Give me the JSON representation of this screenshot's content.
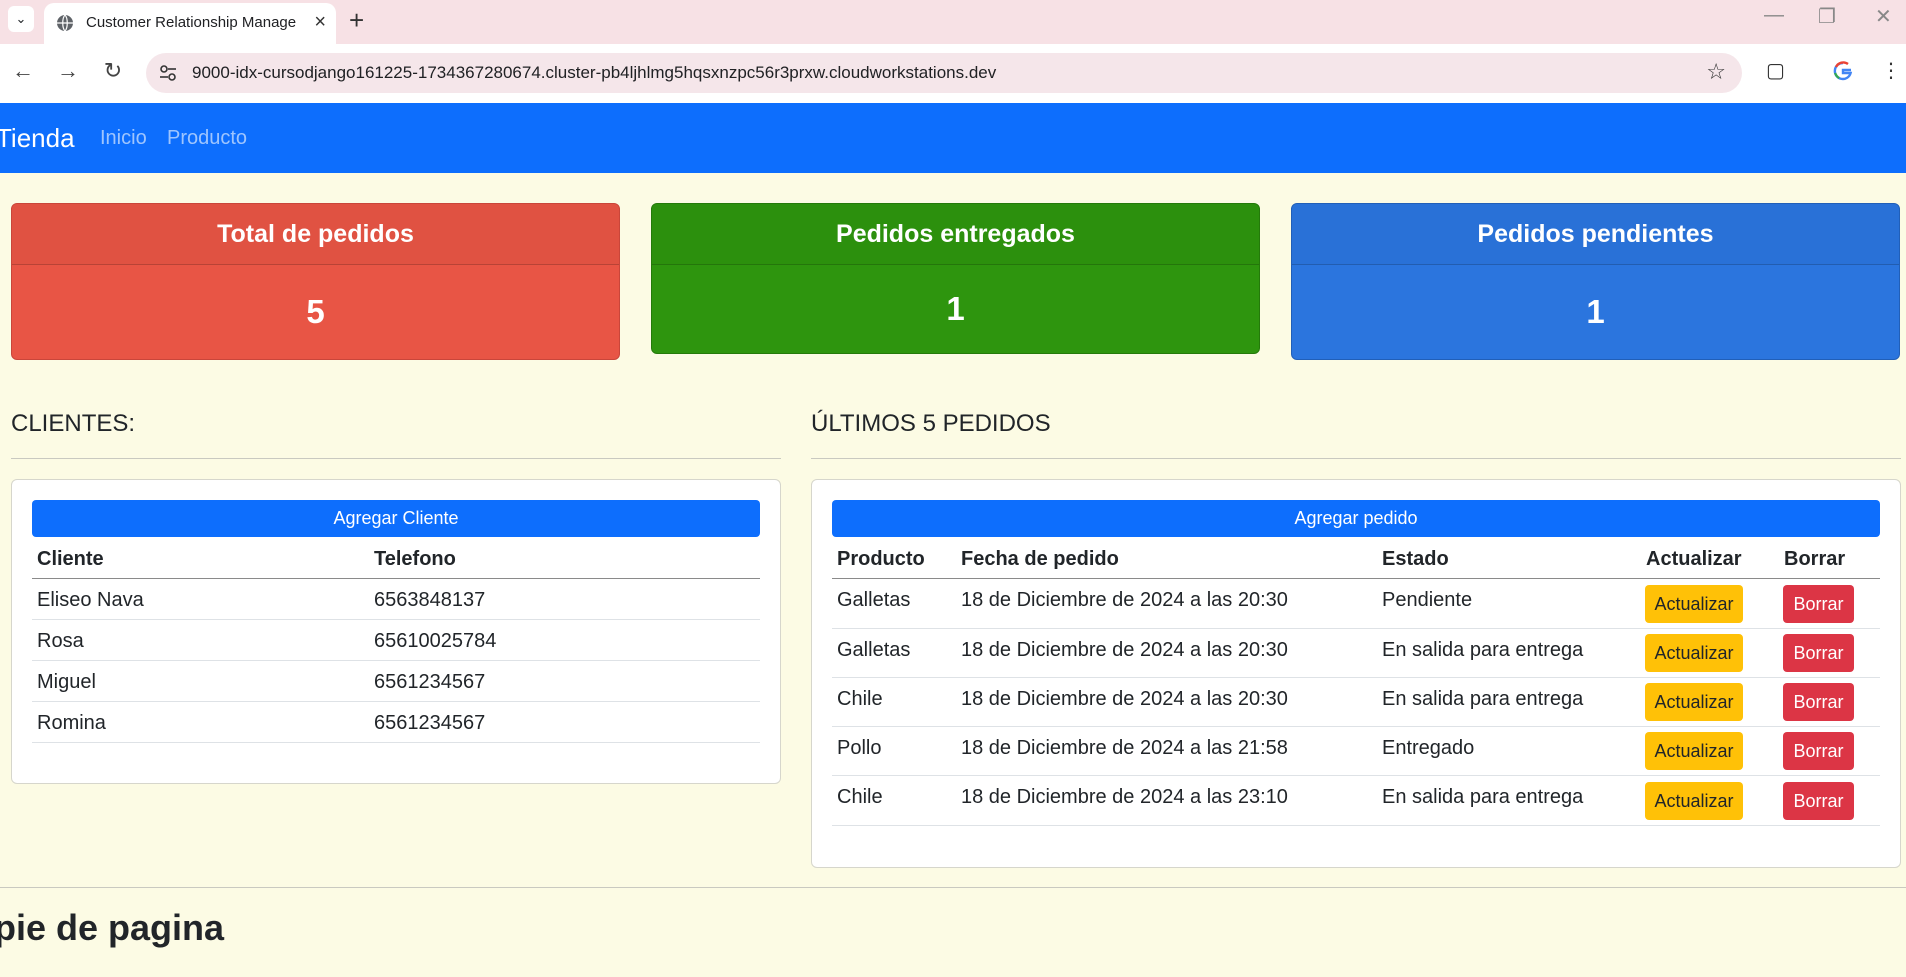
{
  "browser": {
    "tab_title": "Customer Relationship Manage",
    "url": "9000-idx-cursodjango161225-1734367280674.cluster-pb4ljhlmg5hqsxnzpc56r3prxw.cloudworkstations.dev"
  },
  "navbar": {
    "brand": "Tienda",
    "links": [
      "Inicio",
      "Producto"
    ]
  },
  "stats": [
    {
      "title": "Total de pedidos",
      "value": "5",
      "color": "#e85545"
    },
    {
      "title": "Pedidos entregados",
      "value": "1",
      "color": "#2e950e"
    },
    {
      "title": "Pedidos pendientes",
      "value": "1",
      "color": "#2b75de"
    }
  ],
  "clientes": {
    "title": "CLIENTES:",
    "add_button": "Agregar Cliente",
    "headers": [
      "Cliente",
      "Telefono"
    ],
    "rows": [
      [
        "Eliseo Nava",
        "6563848137"
      ],
      [
        "Rosa",
        "65610025784"
      ],
      [
        "Miguel",
        "6561234567"
      ],
      [
        "Romina",
        "6561234567"
      ]
    ]
  },
  "pedidos": {
    "title": "ÚLTIMOS 5 PEDIDOS",
    "add_button": "Agregar pedido",
    "headers": [
      "Producto",
      "Fecha de pedido",
      "Estado",
      "Actualizar",
      "Borrar"
    ],
    "update_label": "Actualizar",
    "delete_label": "Borrar",
    "rows": [
      [
        "Galletas",
        "18 de Diciembre de 2024 a las 20:30",
        "Pendiente"
      ],
      [
        "Galletas",
        "18 de Diciembre de 2024 a las 20:30",
        "En salida para entrega"
      ],
      [
        "Chile",
        "18 de Diciembre de 2024 a las 20:30",
        "En salida para entrega"
      ],
      [
        "Pollo",
        "18 de Diciembre de 2024 a las 21:58",
        "Entregado"
      ],
      [
        "Chile",
        "18 de Diciembre de 2024 a las 23:10",
        "En salida para entrega"
      ]
    ]
  },
  "footer": {
    "text": "pie de pagina"
  }
}
